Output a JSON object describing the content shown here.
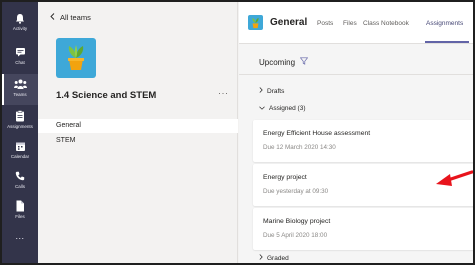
{
  "rail": {
    "items": [
      {
        "label": "Activity",
        "icon": "bell-icon"
      },
      {
        "label": "Chat",
        "icon": "chat-icon"
      },
      {
        "label": "Teams",
        "icon": "teams-icon",
        "active": true
      },
      {
        "label": "Assignments",
        "icon": "assignments-icon"
      },
      {
        "label": "Calendar",
        "icon": "calendar-icon"
      },
      {
        "label": "Calls",
        "icon": "phone-icon"
      },
      {
        "label": "Files",
        "icon": "file-icon"
      },
      {
        "label": "...",
        "icon": "more-icon"
      }
    ]
  },
  "teams_panel": {
    "back_label": "All teams",
    "team_name": "1.4 Science and STEM",
    "more_label": "···",
    "channels": [
      "General",
      "STEM"
    ]
  },
  "header": {
    "title": "General",
    "tabs": [
      "Posts",
      "Files",
      "Class Notebook",
      "Assignments"
    ]
  },
  "main": {
    "filter_label": "Upcoming",
    "drafts_label": "Drafts",
    "assigned_label": "Assigned (3)",
    "graded_label": "Graded",
    "assignments": [
      {
        "title": "Energy Efficient House assessment",
        "due": "Due 12 March 2020 14:30"
      },
      {
        "title": "Energy project",
        "due": "Due yesterday at 09:30"
      },
      {
        "title": "Marine Biology project",
        "due": "Due 5 April 2020 18:00"
      }
    ]
  },
  "colors": {
    "rail": "#33344a",
    "accent": "#6264a7",
    "team_tile": "#3ea8d8",
    "arrow": "#e8141c"
  }
}
